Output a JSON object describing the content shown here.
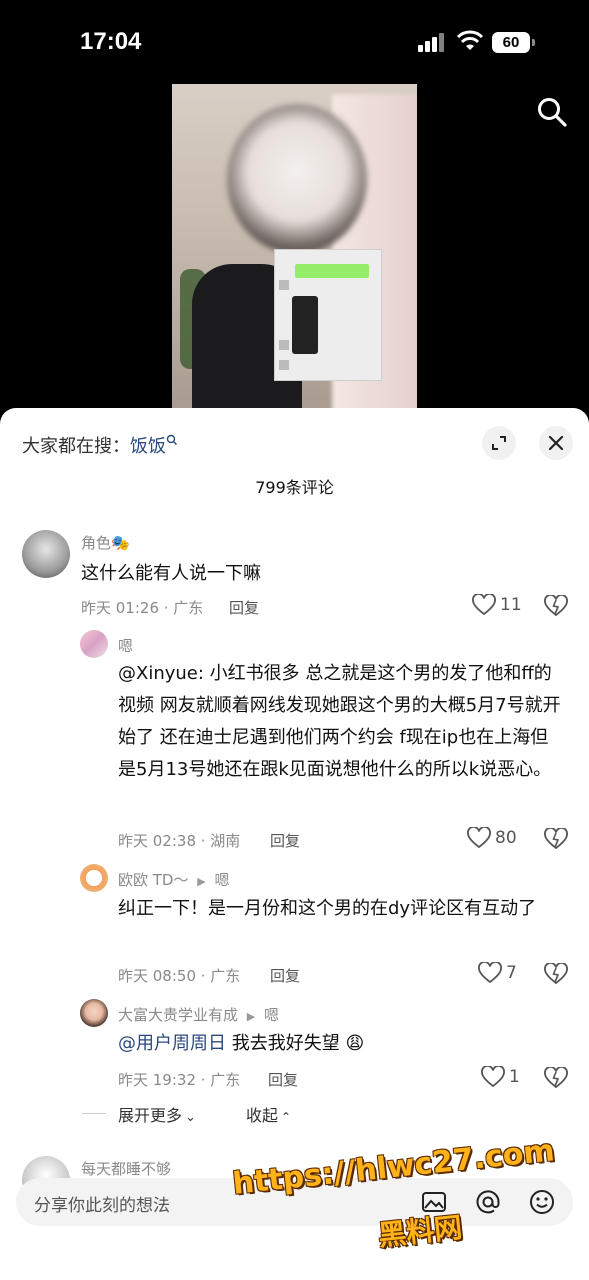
{
  "status_bar": {
    "time": "17:04",
    "battery": "60"
  },
  "header": {
    "hot_prefix": "大家都在搜：",
    "hot_keyword": "饭饭"
  },
  "comments_count": "799条评论",
  "comments": [
    {
      "name": "角色🎭",
      "text": "这什么能有人说一下嘛",
      "time_loc": "昨天 01:26 · 广东",
      "reply_label": "回复",
      "likes": "11"
    }
  ],
  "replies": [
    {
      "name": "嗯",
      "text": "@Xinyue: 小红书很多 总之就是这个男的发了他和ff的视频 网友就顺着网线发现她跟这个男的大概5月7号就开始了  还在迪士尼遇到他们两个约会 f现在ip也在上海但是5月13号她还在跟k见面说想他什么的所以k说恶心。",
      "time_loc": "昨天 02:38 · 湖南",
      "reply_label": "回复",
      "likes": "80"
    },
    {
      "name": "欧欧 TD～",
      "reply_to": "嗯",
      "text": "纠正一下！是一月份和这个男的在dy评论区有互动了",
      "time_loc": "昨天 08:50 · 广东",
      "reply_label": "回复",
      "likes": "7"
    },
    {
      "name": "大富大贵学业有成",
      "reply_to": "嗯",
      "mention": "@用户周周日",
      "text": " 我去我好失望 😩",
      "time_loc": "昨天 19:32 · 广东",
      "reply_label": "回复",
      "likes": "1"
    }
  ],
  "expand": {
    "more_label": "展开更多",
    "collapse_label": "收起"
  },
  "next_comment_name": "每天都睡不够",
  "input": {
    "placeholder": "分享你此刻的想法"
  },
  "watermark": {
    "line1": "https://hlwc27.com",
    "line2": "黑料网"
  },
  "colors": {
    "link": "#2a4a7f",
    "meta": "#8a8a8a",
    "watermark": "#ffb21a"
  }
}
